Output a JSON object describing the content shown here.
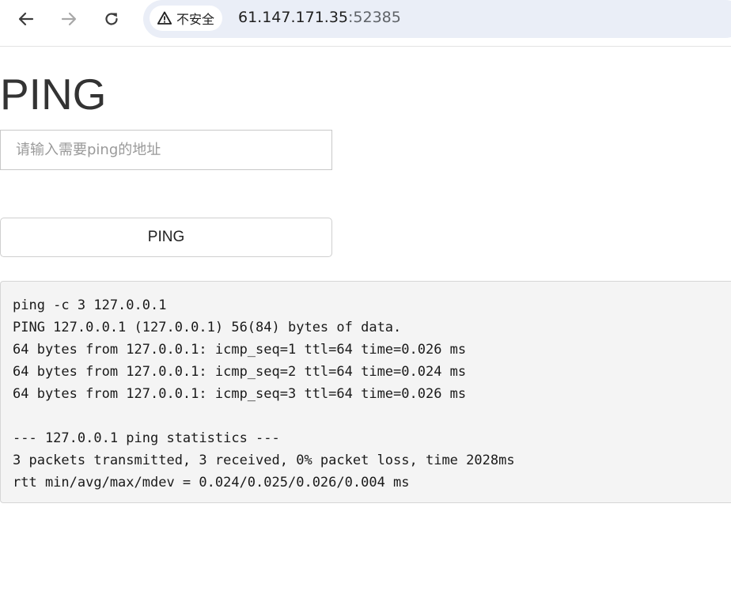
{
  "browser": {
    "back_icon": "arrow-left-icon",
    "forward_icon": "arrow-right-icon",
    "reload_icon": "reload-icon",
    "security_icon": "warning-triangle-icon",
    "security_label": "不安全",
    "url_host": "61.147.171.35",
    "url_port": ":52385"
  },
  "page": {
    "title": "PING",
    "input": {
      "value": "",
      "placeholder": "请输入需要ping的地址"
    },
    "button_label": "PING",
    "output_lines": [
      "ping -c 3 127.0.0.1",
      "PING 127.0.0.1 (127.0.0.1) 56(84) bytes of data.",
      "64 bytes from 127.0.0.1: icmp_seq=1 ttl=64 time=0.026 ms",
      "64 bytes from 127.0.0.1: icmp_seq=2 ttl=64 time=0.024 ms",
      "64 bytes from 127.0.0.1: icmp_seq=3 ttl=64 time=0.026 ms",
      "",
      "--- 127.0.0.1 ping statistics ---",
      "3 packets transmitted, 3 received, 0% packet loss, time 2028ms",
      "rtt min/avg/max/mdev = 0.024/0.025/0.026/0.004 ms"
    ]
  },
  "colors": {
    "omnibox_bg": "#eaeef7",
    "output_bg": "#f4f4f4",
    "text": "#333333"
  }
}
